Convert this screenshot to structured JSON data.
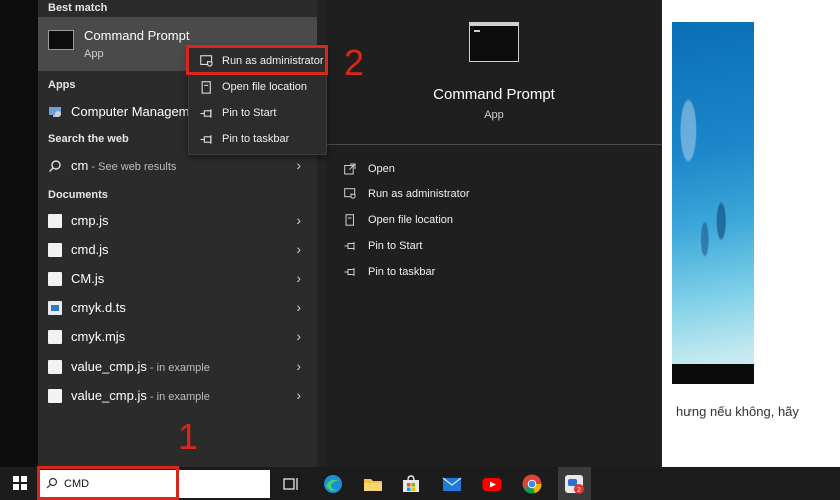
{
  "best_match": {
    "heading": "Best match",
    "title": "Command Prompt",
    "subtitle": "App"
  },
  "apps": {
    "heading": "Apps",
    "items": [
      {
        "label": "Computer Manageme"
      }
    ]
  },
  "search_web": {
    "heading": "Search the web",
    "query": "cm",
    "suffix": " - See web results"
  },
  "documents": {
    "heading": "Documents",
    "items": [
      {
        "name": "cmp.js",
        "suffix": ""
      },
      {
        "name": "cmd.js",
        "suffix": ""
      },
      {
        "name": "CM.js",
        "suffix": ""
      },
      {
        "name": "cmyk.d.ts",
        "suffix": ""
      },
      {
        "name": "cmyk.mjs",
        "suffix": ""
      },
      {
        "name": "value_cmp.js",
        "suffix": " - in example"
      },
      {
        "name": "value_cmp.js",
        "suffix": " - in example"
      }
    ]
  },
  "context_menu": {
    "items": [
      {
        "label": "Run as administrator",
        "icon": "shield-icon"
      },
      {
        "label": "Open file location",
        "icon": "file-location-icon"
      },
      {
        "label": "Pin to Start",
        "icon": "pin-icon"
      },
      {
        "label": "Pin to taskbar",
        "icon": "pin-icon"
      }
    ]
  },
  "detail": {
    "title": "Command Prompt",
    "subtitle": "App",
    "actions": [
      {
        "label": "Open",
        "icon": "open-icon"
      },
      {
        "label": "Run as administrator",
        "icon": "shield-icon"
      },
      {
        "label": "Open file location",
        "icon": "file-location-icon"
      },
      {
        "label": "Pin to Start",
        "icon": "pin-icon"
      },
      {
        "label": "Pin to taskbar",
        "icon": "pin-icon"
      }
    ]
  },
  "taskbar": {
    "search_value": "CMD",
    "badge": "2"
  },
  "annotations": {
    "step1": "1",
    "step2": "2"
  },
  "background_page": {
    "text": "hưng nếu không, hãy"
  },
  "colors": {
    "highlight_red": "#d9271c",
    "menu_bg": "#2b2b2b",
    "panel_bg": "#1f1f1f",
    "taskbar_bg": "#1c1c1c"
  }
}
